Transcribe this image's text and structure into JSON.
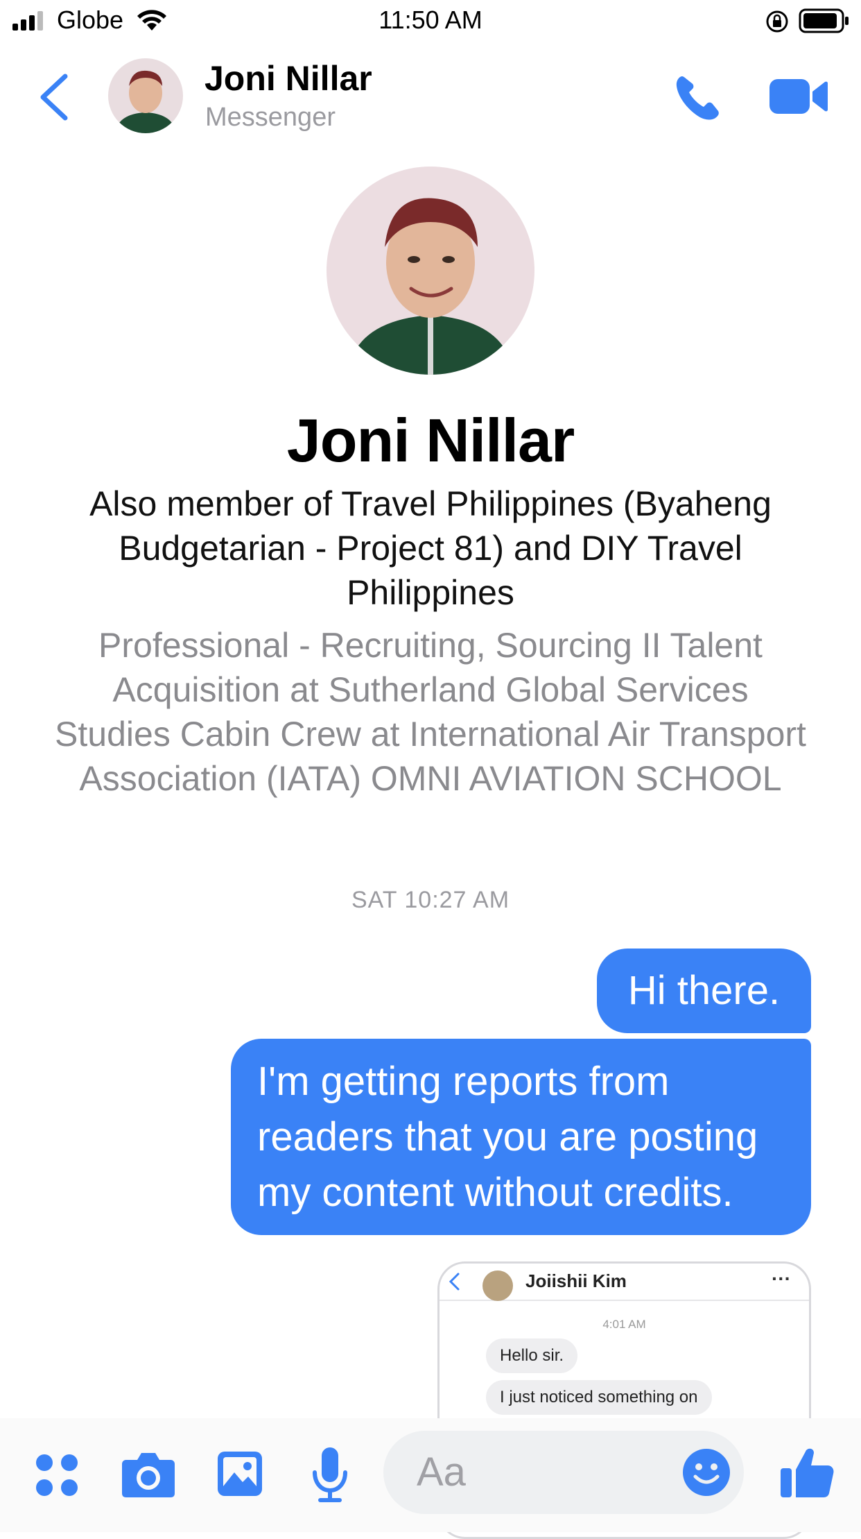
{
  "status_bar": {
    "carrier": "Globe",
    "time": "11:50 AM"
  },
  "header": {
    "name": "Joni Nillar",
    "subtitle": "Messenger"
  },
  "profile": {
    "name": "Joni Nillar",
    "groups": "Also member of Travel Philippines (Byaheng Budgetarian - Project 81) and DIY Travel Philippines",
    "work": "Professional - Recruiting, Sourcing II Talent Acquisition at Sutherland Global Services",
    "education": "Studies Cabin Crew at International Air Transport Association (IATA) OMNI AVIATION SCHOOL"
  },
  "conversation": {
    "timestamp": "SAT 10:27 AM",
    "messages": [
      {
        "text": "Hi there."
      },
      {
        "text": "I'm getting reports from readers that you are posting my content without credits."
      }
    ],
    "attachment": {
      "contact_name": "Joiishii Kim",
      "time": "4:01 AM",
      "messages": [
        "Hello sir.",
        "I just noticed something on"
      ]
    }
  },
  "composer": {
    "placeholder": "Aa"
  },
  "colors": {
    "accent": "#3a82f6",
    "secondary_text": "#8a8a8e"
  },
  "icons": [
    "back-chevron-icon",
    "phone-icon",
    "video-camera-icon",
    "apps-icon",
    "camera-icon",
    "image-icon",
    "microphone-icon",
    "emoji-icon",
    "thumbs-up-icon"
  ]
}
